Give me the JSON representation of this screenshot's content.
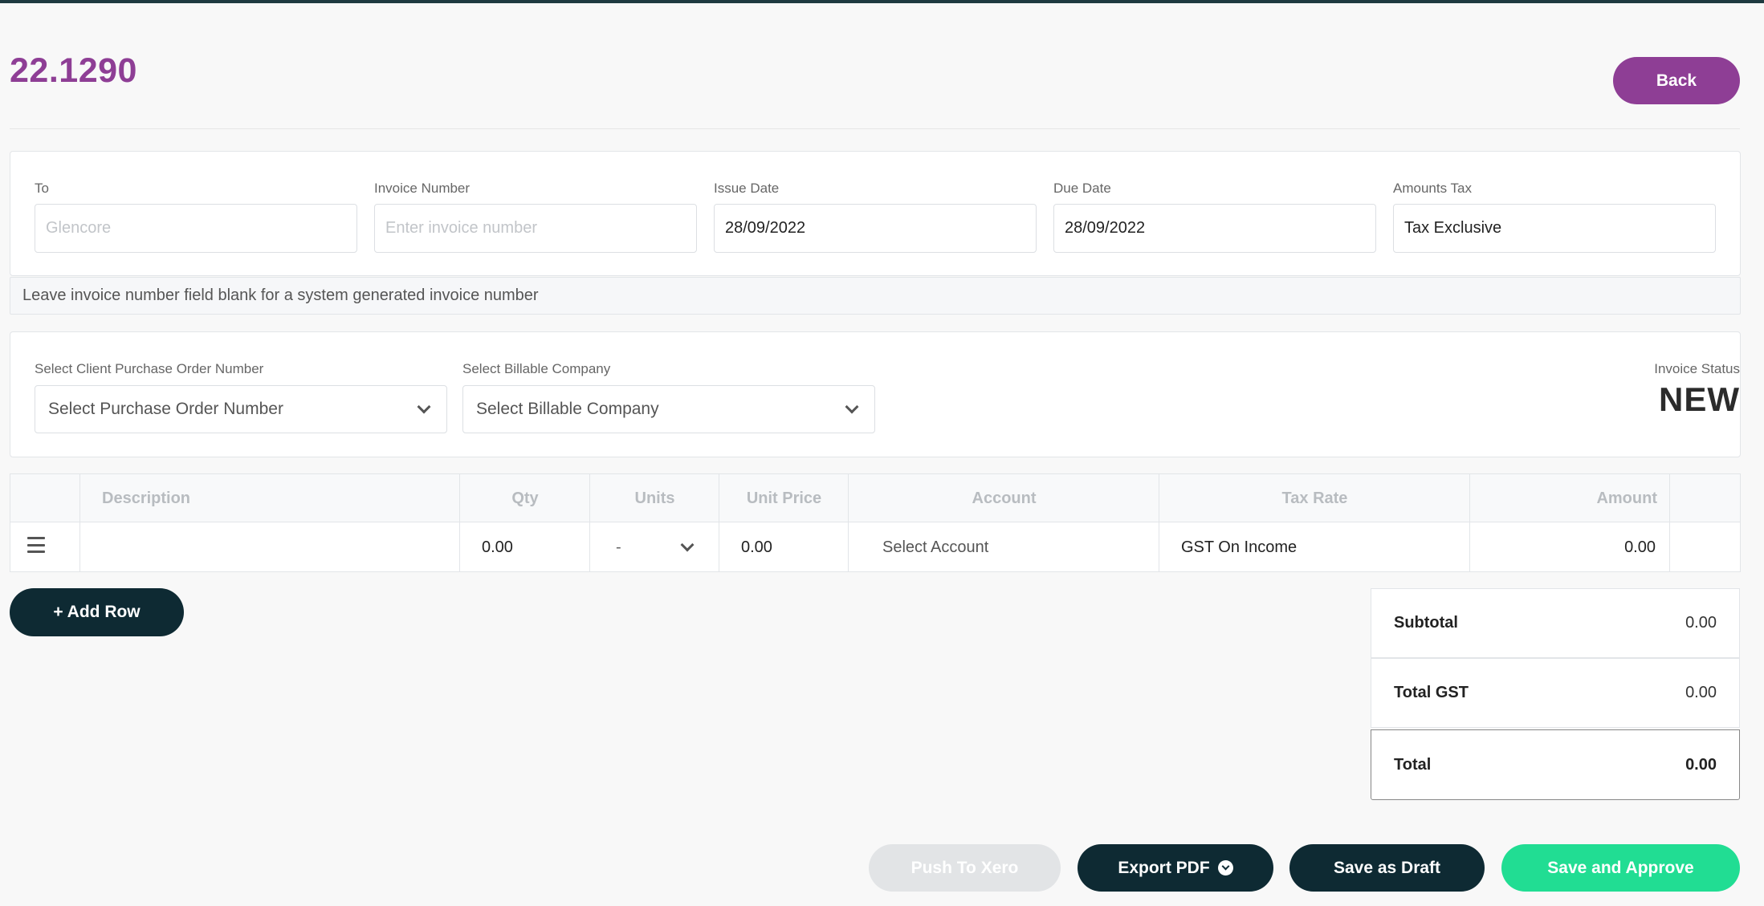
{
  "header": {
    "invoice_id": "22.1290",
    "back_label": "Back"
  },
  "invoice_form": {
    "to_label": "To",
    "to_placeholder": "Glencore",
    "number_label": "Invoice Number",
    "number_placeholder": "Enter invoice number",
    "issue_date_label": "Issue Date",
    "issue_date_value": "28/09/2022",
    "due_date_label": "Due Date",
    "due_date_value": "28/09/2022",
    "amounts_tax_label": "Amounts Tax",
    "amounts_tax_value": "Tax Exclusive",
    "note": "Leave invoice number field blank for a system generated invoice number"
  },
  "selection": {
    "po_label": "Select Client Purchase Order Number",
    "po_value": "Select Purchase Order Number",
    "company_label": "Select Billable Company",
    "company_value": "Select Billable Company",
    "status_label": "Invoice Status",
    "status_value": "NEW"
  },
  "items_table": {
    "headers": {
      "description": "Description",
      "qty": "Qty",
      "units": "Units",
      "unit_price": "Unit Price",
      "account": "Account",
      "tax_rate": "Tax Rate",
      "amount": "Amount"
    },
    "rows": [
      {
        "description": "",
        "qty": "0.00",
        "units": "-",
        "unit_price": "0.00",
        "account": "Select Account",
        "tax_rate": "GST On Income",
        "amount": "0.00"
      }
    ]
  },
  "actions": {
    "add_row_label": "+ Add Row",
    "push_xero_label": "Push To Xero",
    "export_pdf_label": "Export PDF",
    "save_draft_label": "Save as Draft",
    "save_approve_label": "Save and Approve"
  },
  "totals": {
    "subtotal_label": "Subtotal",
    "subtotal_value": "0.00",
    "gst_label": "Total GST",
    "gst_value": "0.00",
    "total_label": "Total",
    "total_value": "0.00"
  },
  "colors": {
    "brand_purple": "#8e3e95",
    "dark_navy": "#0e2a33",
    "approve_green": "#21dd93",
    "disabled_gray": "#e2e4e6"
  }
}
